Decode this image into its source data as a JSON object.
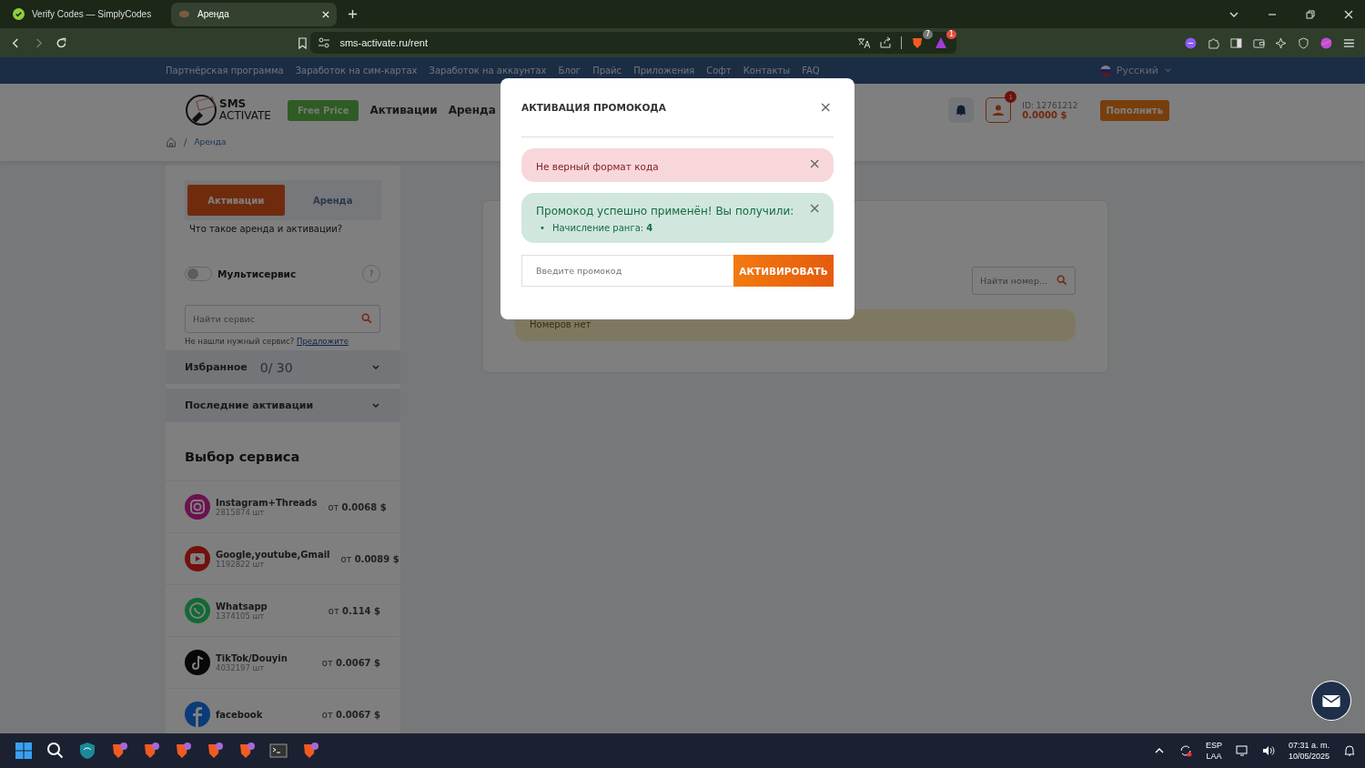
{
  "browser": {
    "tabs": [
      {
        "title": "Verify Codes — SimplyCodes",
        "selected": false
      },
      {
        "title": "Аренда",
        "selected": true
      }
    ],
    "url": "sms-activate.ru/rent",
    "shield_count": "7",
    "rewards_count": "1"
  },
  "site_nav": {
    "links": [
      "Партнёрская программа",
      "Заработок на сим-картах",
      "Заработок на аккаунтах",
      "Блог",
      "Прайс",
      "Приложения",
      "Софт",
      "Контакты",
      "FAQ"
    ],
    "language": "Русский"
  },
  "header": {
    "logo": [
      "SMS",
      "ACTIVATE"
    ],
    "free_price": "Free Price",
    "nav": [
      "Активации",
      "Аренда"
    ],
    "notification_count": "1",
    "user_id": "ID: 12761212",
    "balance": "0.0000 $",
    "top_up": "Пополнить"
  },
  "breadcrumb": [
    {
      "separator": "/",
      "label": "Аренда"
    }
  ],
  "sidebar": {
    "mode_tabs": [
      {
        "label": "Активации",
        "selected": true
      },
      {
        "label": "Аренда",
        "selected": false
      }
    ],
    "help_link": "Что такое аренда и активации?",
    "multiservice": {
      "label": "Мультисервис",
      "on": false,
      "help": "?"
    },
    "service_search": {
      "placeholder": "Найти сервис"
    },
    "suggest_text": "Не нашли нужный сервис?",
    "suggest_link": "Предложите",
    "favorites": {
      "label": "Избранное",
      "count": "0/ 30"
    },
    "recent": {
      "label": "Последние активации"
    },
    "services_title": "Выбор сервиса",
    "services": [
      {
        "name": "Instagram+Threads",
        "count": "2815874 шт",
        "price": "от **0.0068 $**",
        "kind": "instagram"
      },
      {
        "name": "Google,youtube,Gmail",
        "count": "1192822 шт",
        "price": "от **0.0089 $**",
        "kind": "youtube"
      },
      {
        "name": "Whatsapp",
        "count": "1374105 шт",
        "price": "от **0.114 $**",
        "kind": "whatsapp"
      },
      {
        "name": "TikTok/Douyin",
        "count": "4032197 шт",
        "price": "от **0.0067 $**",
        "kind": "tiktok"
      },
      {
        "name": "facebook",
        "price": "от **0.0067 $**",
        "kind": "facebook"
      }
    ]
  },
  "content": {
    "number_search": {
      "placeholder": "Найти номер..."
    },
    "empty": "Номеров нет"
  },
  "modal": {
    "title": "АКТИВАЦИЯ ПРОМОКОДА",
    "close": "×",
    "alerts": [
      {
        "kind": "error",
        "text": "Не верный формат кода",
        "close": "×"
      },
      {
        "kind": "success",
        "text": "Промокод успешно применён! Вы получили:",
        "items": [
          {
            "bullet": "•",
            "text": "Начисление ранга: **4**"
          }
        ],
        "close": "×"
      }
    ],
    "input": {
      "placeholder": "Введите промокод"
    },
    "submit": "АКТИВИРОВАТЬ"
  },
  "taskbar": {
    "lang": "ESP",
    "layout": "LAA",
    "time": "07:31 a. m.",
    "date": "10/05/2025"
  }
}
